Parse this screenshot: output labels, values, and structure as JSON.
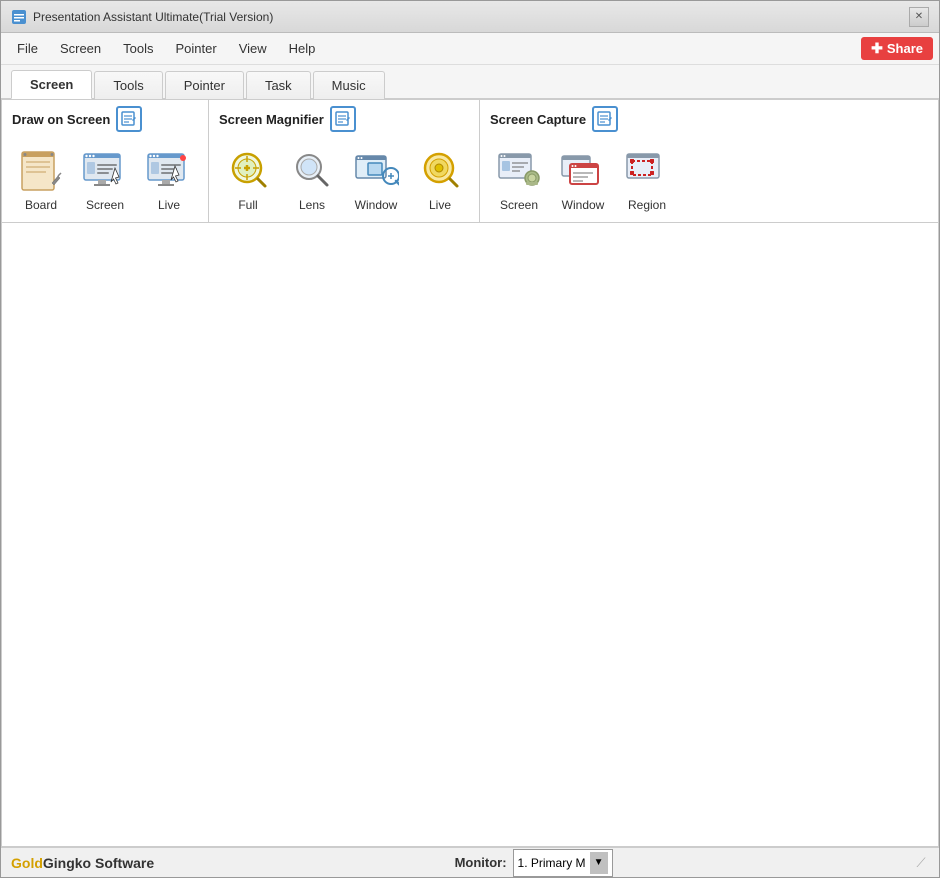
{
  "window": {
    "title": "Presentation Assistant Ultimate(Trial Version)"
  },
  "titlebar": {
    "close_label": "✕"
  },
  "menubar": {
    "items": [
      "File",
      "Screen",
      "Tools",
      "Pointer",
      "View",
      "Help"
    ],
    "share_label": "Share"
  },
  "tabs": [
    {
      "label": "Screen",
      "active": true
    },
    {
      "label": "Tools",
      "active": false
    },
    {
      "label": "Pointer",
      "active": false
    },
    {
      "label": "Task",
      "active": false
    },
    {
      "label": "Music",
      "active": false
    }
  ],
  "sections": {
    "draw_on_screen": {
      "title": "Draw on Screen",
      "tools": [
        {
          "label": "Board",
          "icon": "board"
        },
        {
          "label": "Screen",
          "icon": "screen-draw"
        },
        {
          "label": "Live",
          "icon": "live-draw"
        }
      ]
    },
    "screen_magnifier": {
      "title": "Screen Magnifier",
      "tools": [
        {
          "label": "Full",
          "icon": "full-mag"
        },
        {
          "label": "Lens",
          "icon": "lens-mag"
        },
        {
          "label": "Window",
          "icon": "window-mag"
        },
        {
          "label": "Live",
          "icon": "live-mag"
        }
      ]
    },
    "screen_capture": {
      "title": "Screen Capture",
      "tools": [
        {
          "label": "Screen",
          "icon": "screen-cap"
        },
        {
          "label": "Window",
          "icon": "window-cap"
        },
        {
          "label": "Region",
          "icon": "region-cap"
        }
      ]
    }
  },
  "statusbar": {
    "brand_gold": "Gold",
    "brand_rest": "Gingko Software",
    "monitor_label": "Monitor:",
    "monitor_value": "1. Primary M"
  }
}
